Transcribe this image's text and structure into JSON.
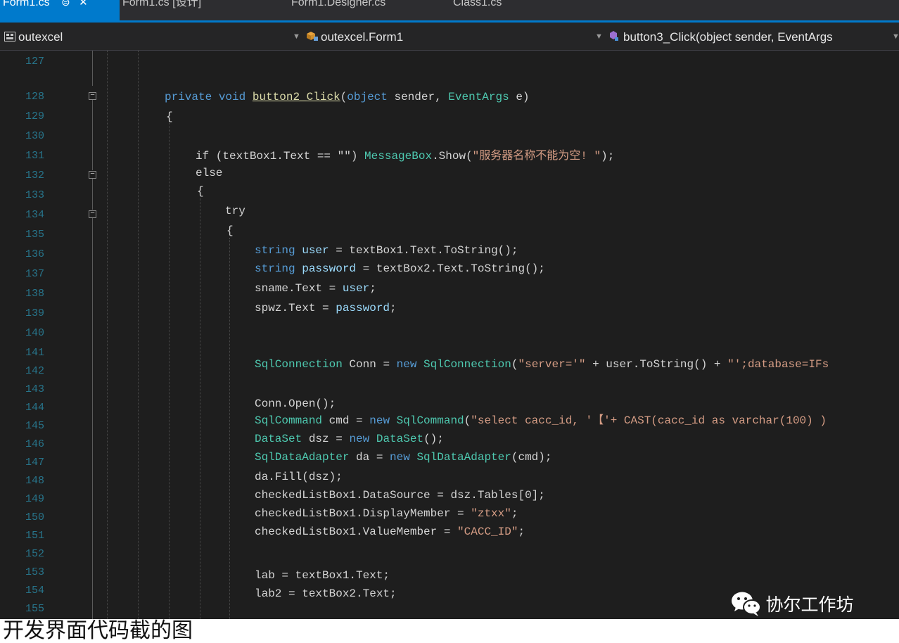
{
  "tabs": [
    {
      "label": "Form1.cs",
      "active": true,
      "pin": "⊜",
      "close": "✕"
    },
    {
      "label": "Form1.cs [设计]",
      "active": false
    },
    {
      "label": "Form1.Designer.cs",
      "active": false
    },
    {
      "label": "Class1.cs",
      "active": false
    }
  ],
  "navbar": {
    "project": "outexcel",
    "class": "outexcel.Form1",
    "member": "button3_Click(object sender, EventArgs"
  },
  "editor": {
    "line_numbers": [
      "127",
      "128",
      "129",
      "130",
      "131",
      "132",
      "133",
      "134",
      "135",
      "136",
      "137",
      "138",
      "139",
      "140",
      "141",
      "142",
      "143",
      "144",
      "145",
      "146",
      "147",
      "148",
      "149",
      "150",
      "151",
      "152",
      "153",
      "154",
      "155"
    ],
    "code": {
      "l128_kw": "private void ",
      "l128_method": "button2_Click",
      "l128_paren": "(",
      "l128_type": "object",
      "l128_rest": " sender, ",
      "l128_type2": "EventArgs",
      "l128_end": " e)",
      "l129": "{",
      "l131_a": "if (textBox1.Text == \"\") ",
      "l131_b": "MessageBox",
      "l131_c": ".Show(",
      "l131_d": "\"服务器名称不能为空! \"",
      "l131_e": ");",
      "l132": "else",
      "l133": "{",
      "l134": "try",
      "l135": "{",
      "l136_a": "string ",
      "l136_b": "user",
      "l136_c": " = textBox1.Text.ToString();",
      "l137_a": "string ",
      "l137_b": "password",
      "l137_c": " = textBox2.Text.ToString();",
      "l138_a": "sname.Text = ",
      "l138_b": "user",
      "l138_c": ";",
      "l139_a": "spwz.Text = ",
      "l139_b": "password",
      "l139_c": ";",
      "l142_a": "SqlConnection",
      "l142_b": " Conn = ",
      "l142_c": "new ",
      "l142_d": "SqlConnection",
      "l142_e": "(",
      "l142_f": "\"server='\"",
      "l142_g": " + user.ToString() + ",
      "l142_h": "\"';database=IFs",
      "l144": "Conn.Open();",
      "l145_a": "SqlCommand",
      "l145_b": " cmd = ",
      "l145_c": "new ",
      "l145_d": "SqlCommand",
      "l145_e": "(",
      "l145_f": "\"select cacc_id, '【'+ CAST(cacc_id as varchar(100) )",
      "l146_a": "DataSet",
      "l146_b": " dsz = ",
      "l146_c": "new ",
      "l146_d": "DataSet",
      "l146_e": "();",
      "l147_a": "SqlDataAdapter",
      "l147_b": " da = ",
      "l147_c": "new ",
      "l147_d": "SqlDataAdapter",
      "l147_e": "(cmd);",
      "l148": "da.Fill(dsz);",
      "l149": "checkedListBox1.DataSource = dsz.Tables[0];",
      "l150_a": "checkedListBox1.DisplayMember = ",
      "l150_b": "\"ztxx\"",
      "l150_c": ";",
      "l151_a": "checkedListBox1.ValueMember = ",
      "l151_b": "\"CACC_ID\"",
      "l151_c": ";",
      "l153": "lab = textBox1.Text;",
      "l154": "lab2 = textBox2.Text;"
    }
  },
  "watermark": {
    "text": "协尔工作坊",
    "icon": "wechat-icon"
  },
  "caption": "开发界面代码截的图"
}
